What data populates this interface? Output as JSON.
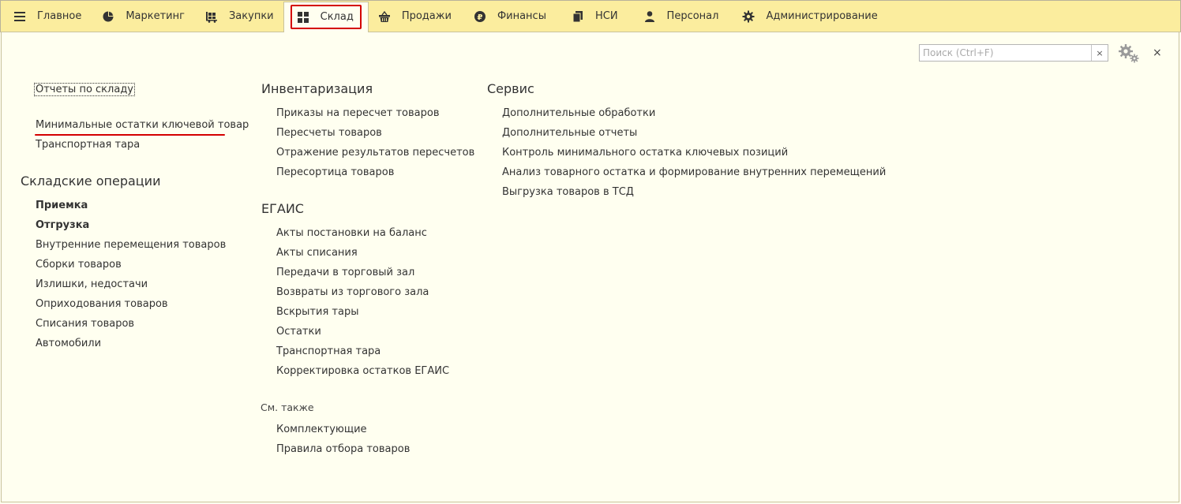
{
  "tabs": [
    {
      "label": "Главное",
      "icon": "menu-icon"
    },
    {
      "label": "Маркетинг",
      "icon": "pie-chart-icon"
    },
    {
      "label": "Закупки",
      "icon": "cart-icon"
    },
    {
      "label": "Склад",
      "icon": "warehouse-grid-icon",
      "active": true
    },
    {
      "label": "Продажи",
      "icon": "basket-icon"
    },
    {
      "label": "Финансы",
      "icon": "ruble-coin-icon"
    },
    {
      "label": "НСИ",
      "icon": "documents-icon"
    },
    {
      "label": "Персонал",
      "icon": "person-icon"
    },
    {
      "label": "Администрирование",
      "icon": "gear-icon"
    }
  ],
  "search": {
    "placeholder": "Поиск (Ctrl+F)",
    "clear": "×"
  },
  "close": "×",
  "left": {
    "reports": "Отчеты по складу",
    "report_items": [
      "Минимальные остатки ключевой товар",
      "Транспортная тара"
    ],
    "ops_title": "Складские операции",
    "ops_items": [
      "Приемка",
      "Отгрузка",
      "Внутренние перемещения товаров",
      "Сборки товаров",
      "Излишки, недостачи",
      "Оприходования товаров",
      "Списания товаров",
      "Автомобили"
    ]
  },
  "middle": {
    "inv_title": "Инвентаризация",
    "inv_items": [
      "Приказы на пересчет товаров",
      "Пересчеты товаров",
      "Отражение результатов пересчетов",
      "Пересортица товаров"
    ],
    "egais_title": "ЕГАИС",
    "egais_items": [
      "Акты постановки на баланс",
      "Акты списания",
      "Передачи в торговый зал",
      "Возвраты из торгового зала",
      "Вскрытия тары",
      "Остатки",
      "Транспортная тара",
      "Корректировка остатков ЕГАИС"
    ],
    "see_also_title": "См. также",
    "see_also_items": [
      "Комплектующие",
      "Правила отбора товаров"
    ]
  },
  "right": {
    "service_title": "Сервис",
    "service_items": [
      "Дополнительные обработки",
      "Дополнительные отчеты",
      "Контроль минимального остатка ключевых позиций",
      "Анализ товарного остатка и формирование внутренних перемещений",
      "Выгрузка товаров в ТСД"
    ]
  },
  "colors": {
    "accent_green": "#2f9a4d",
    "highlight_red": "#d40000",
    "topbar": "#fbed9e",
    "page": "#fffff0"
  }
}
